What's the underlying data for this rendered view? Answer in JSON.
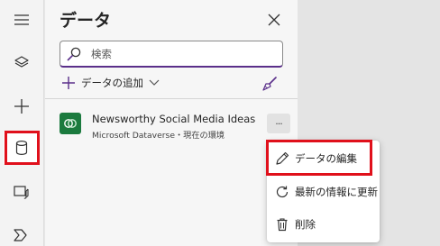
{
  "panel": {
    "title": "データ",
    "search": {
      "placeholder": "検索",
      "value": ""
    },
    "add_data_label": "データの追加"
  },
  "data_source": {
    "name": "Newsworthy Social Media Ideas",
    "subtitle": "Microsoft Dataverse・現在の環境",
    "more_label": "···"
  },
  "context_menu": {
    "items": [
      {
        "label": "データの編集",
        "icon": "pencil-icon"
      },
      {
        "label": "最新の情報に更新",
        "icon": "refresh-icon"
      },
      {
        "label": "削除",
        "icon": "trash-icon"
      }
    ]
  },
  "rail": {
    "items": [
      {
        "icon": "hamburger-menu-icon"
      },
      {
        "icon": "layers-icon"
      },
      {
        "icon": "plus-icon"
      },
      {
        "icon": "database-icon",
        "selected": true
      },
      {
        "icon": "media-icon"
      },
      {
        "icon": "power-automate-icon"
      }
    ]
  },
  "colors": {
    "highlight": "#e0101b",
    "accent": "#5a2f8a",
    "dataverse_green": "#1b7a3e"
  }
}
